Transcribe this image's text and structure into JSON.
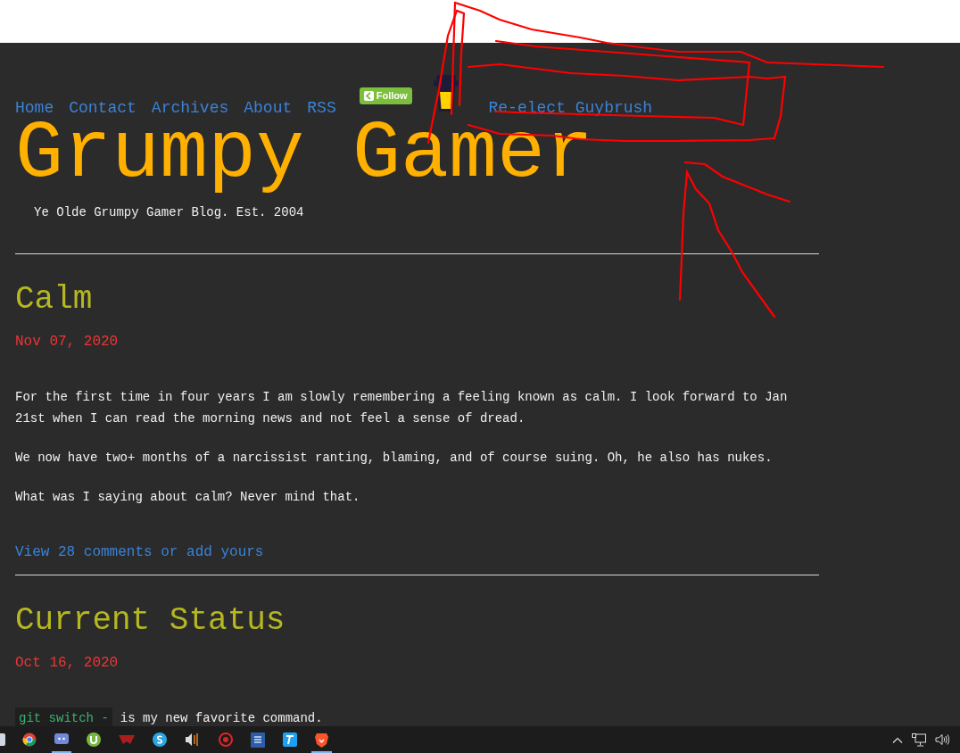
{
  "nav": [
    {
      "kind": "link",
      "label": "Home"
    },
    {
      "kind": "link",
      "label": "Contact"
    },
    {
      "kind": "link",
      "label": "Archives"
    },
    {
      "kind": "link",
      "label": "About"
    },
    {
      "kind": "link",
      "label": "RSS"
    },
    {
      "kind": "follow",
      "label": "Follow"
    },
    {
      "kind": "cup"
    },
    {
      "kind": "link",
      "label": "Re-elect Guybrush"
    }
  ],
  "site": {
    "title": "Grumpy Gamer",
    "tagline": "Ye Olde Grumpy Gamer Blog. Est. 2004"
  },
  "posts": [
    {
      "title": "Calm",
      "date": "Nov 07, 2020",
      "paragraphs": [
        {
          "kind": "text",
          "text": "For the first time in four years I am slowly remembering a feeling known as calm. I look forward to Jan 21st when I can read the morning news and not feel a sense of dread."
        },
        {
          "kind": "text",
          "text": "We now have two+ months of a narcissist ranting, blaming, and of course suing. Oh, he also has nukes."
        },
        {
          "kind": "text",
          "text": "What was I saying about calm? Never mind that."
        }
      ],
      "comments": "View 28 comments or add yours"
    },
    {
      "title": "Current Status",
      "date": "Oct 16, 2020",
      "paragraphs": [
        {
          "kind": "code",
          "code": "git switch -",
          "text": "is my new favorite command."
        }
      ]
    }
  ]
}
